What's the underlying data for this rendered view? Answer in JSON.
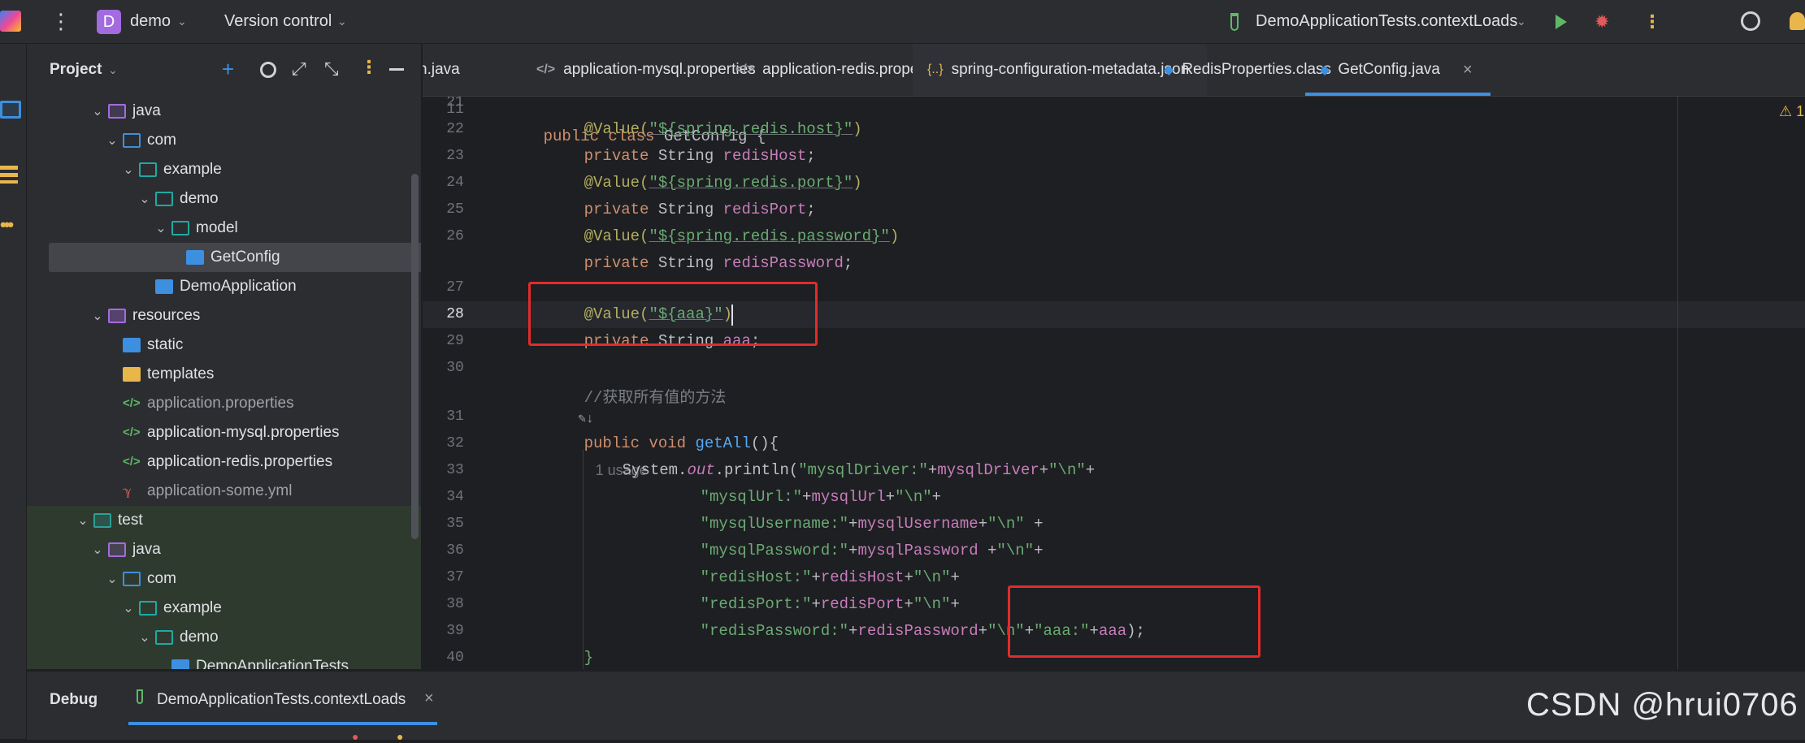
{
  "topbar": {
    "project_badge": "D",
    "project_name": "demo",
    "vcs_label": "Version control",
    "run_config": "DemoApplicationTests.contextLoads"
  },
  "panel": {
    "title": "Project",
    "tree": [
      {
        "label": "java",
        "chev": "⌄",
        "icon": "src"
      },
      {
        "label": "com",
        "chev": "⌄",
        "icon": "pkg"
      },
      {
        "label": "example",
        "chev": "⌄",
        "icon": "pkg-green"
      },
      {
        "label": "demo",
        "chev": "⌄",
        "icon": "pkg-green"
      },
      {
        "label": "model",
        "chev": "⌄",
        "icon": "pkg-green"
      },
      {
        "label": "GetConfig",
        "chev": "",
        "icon": "class",
        "selected": true
      },
      {
        "label": "DemoApplication",
        "chev": "",
        "icon": "class"
      },
      {
        "label": "resources",
        "chev": "⌄",
        "icon": "res"
      },
      {
        "label": "static",
        "chev": "",
        "icon": "static"
      },
      {
        "label": "templates",
        "chev": "",
        "icon": "tmpl"
      },
      {
        "label": "application.properties",
        "chev": "",
        "icon": "props",
        "dim": true
      },
      {
        "label": "application-mysql.properties",
        "chev": "",
        "icon": "props"
      },
      {
        "label": "application-redis.properties",
        "chev": "",
        "icon": "props"
      },
      {
        "label": "application-some.yml",
        "chev": "",
        "icon": "yml",
        "dim": true
      },
      {
        "label": "test",
        "chev": "⌄",
        "icon": "test",
        "test": true
      },
      {
        "label": "java",
        "chev": "⌄",
        "icon": "src",
        "test": true
      },
      {
        "label": "com",
        "chev": "⌄",
        "icon": "pkg",
        "test": true
      },
      {
        "label": "example",
        "chev": "⌄",
        "icon": "pkg-green",
        "test": true
      },
      {
        "label": "demo",
        "chev": "⌄",
        "icon": "pkg-green",
        "test": true
      },
      {
        "label": "DemoApplicationTests",
        "chev": "",
        "icon": "class",
        "test": true
      }
    ]
  },
  "tabs": [
    {
      "label": "n.java",
      "icon": ""
    },
    {
      "label": "application-mysql.properties",
      "icon": "</>"
    },
    {
      "label": "application-redis.properties",
      "icon": "</>"
    },
    {
      "label": "spring-configuration-metadata.json",
      "icon": "{..}"
    },
    {
      "label": "RedisProperties.class",
      "icon": "◆"
    },
    {
      "label": "GetConfig.java",
      "icon": "◆",
      "active": true
    }
  ],
  "editor": {
    "line_numbers": [
      "11",
      "21",
      "22",
      "23",
      "24",
      "25",
      "26",
      "27",
      "28",
      "29",
      "30",
      "",
      "31",
      "32",
      "33",
      "34",
      "35",
      "36",
      "37",
      "38",
      "39",
      "40"
    ],
    "current_line": "28",
    "warning_count": "1",
    "usage_hint": "1 usage",
    "comment": "//获取所有值的方法",
    "lines": {
      "l11": {
        "kw1": "public class ",
        "name": "GetConfig {"
      },
      "l21": {
        "anno": "@Value(",
        "str": "\"${spring.redis.host}\"",
        "end": ")"
      },
      "l22": {
        "kw": "private ",
        "type": "String ",
        "field": "redisHost",
        "end": ";"
      },
      "l23": {
        "anno": "@Value(",
        "str": "\"${spring.redis.port}\"",
        "end": ")"
      },
      "l24": {
        "kw": "private ",
        "type": "String ",
        "field": "redisPort",
        "end": ";"
      },
      "l25": {
        "anno": "@Value(",
        "str": "\"${spring.redis.password}\"",
        "end": ")"
      },
      "l26": {
        "kw": "private ",
        "type": "String ",
        "field": "redisPassword",
        "end": ";"
      },
      "l27": {
        "anno": "@Value(",
        "str": "\"${aaa}\"",
        "end": ")"
      },
      "l28": {
        "kw": "private ",
        "type": "String ",
        "field": "aaa",
        "end": ";"
      },
      "l31": {
        "kw": "public void ",
        "meth": "getAll",
        "end": "(){"
      },
      "l32": {
        "a": "System.",
        "b": "out",
        "c": ".println(",
        "s": "\"mysqlDriver:\"",
        "p": "+",
        "f": "mysqlDriver",
        "q": "+",
        "s2": "\"\\n\"",
        "e": "+"
      },
      "l33": {
        "s": "\"mysqlUrl:\"",
        "p": "+",
        "f": "mysqlUrl",
        "q": "+",
        "s2": "\"\\n\"",
        "e": "+"
      },
      "l34": {
        "s": "\"mysqlUsername:\"",
        "p": "+",
        "f": "mysqlUsername",
        "q": "+",
        "s2": "\"\\n\"",
        "e": " +"
      },
      "l35": {
        "s": "\"mysqlPassword:\"",
        "p": "+",
        "f": "mysqlPassword",
        "q": " +",
        "s2": "\"\\n\"",
        "e": "+"
      },
      "l36": {
        "s": "\"redisHost:\"",
        "p": "+",
        "f": "redisHost",
        "q": "+",
        "s2": "\"\\n\"",
        "e": "+"
      },
      "l37": {
        "s": "\"redisPort:\"",
        "p": "+",
        "f": "redisPort",
        "q": "+",
        "s2": "\"\\n\"",
        "e": "+"
      },
      "l38": {
        "s": "\"redisPassword:\"",
        "p": "+",
        "f": "redisPassword",
        "q": "+",
        "s2": "\"\\n\"",
        "r": "+",
        "s3": "\"aaa:\"",
        "p2": "+",
        "f2": "aaa",
        "e": ");"
      },
      "l39": {
        "end": "}"
      },
      "l40": {
        "end": "}"
      }
    }
  },
  "debug": {
    "title": "Debug",
    "tab_label": "DemoApplicationTests.contextLoads"
  },
  "watermark": "CSDN @hrui0706",
  "colors": {
    "accent": "#3d8fe0",
    "highlight_box": "#e32b2b",
    "keyword": "#cf8e6d",
    "string": "#6aab73",
    "field": "#c77dbb"
  }
}
